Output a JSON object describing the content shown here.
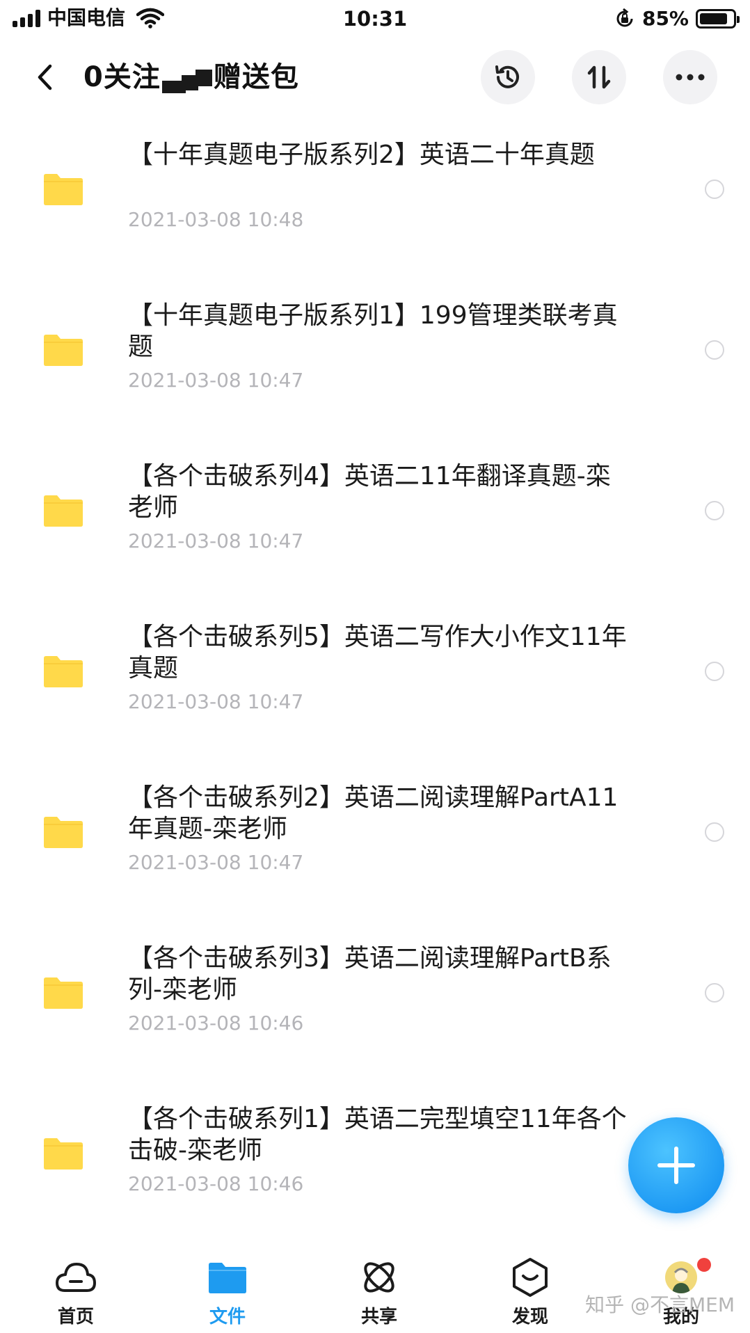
{
  "status_bar": {
    "carrier": "中国电信",
    "time": "10:31",
    "battery_percent": "85%",
    "battery_level": 0.85
  },
  "header": {
    "title_prefix": "0关注",
    "title_suffix": "赠送包",
    "buttons": {
      "back": "chevron-left-icon",
      "history": "history-icon",
      "sort": "sort-icon",
      "more": "more-horizontal-icon"
    }
  },
  "files": [
    {
      "name": "【十年真题电子版系列2】英语二十年真题",
      "date": "2021-03-08 10:48"
    },
    {
      "name": "【十年真题电子版系列1】199管理类联考真题",
      "date": "2021-03-08 10:47"
    },
    {
      "name": "【各个击破系列4】英语二11年翻译真题-栾老师",
      "date": "2021-03-08 10:47"
    },
    {
      "name": "【各个击破系列5】英语二写作大小作文11年真题",
      "date": "2021-03-08 10:47"
    },
    {
      "name": "【各个击破系列2】英语二阅读理解PartA11年真题-栾老师",
      "date": "2021-03-08 10:47"
    },
    {
      "name": "【各个击破系列3】英语二阅读理解PartB系列-栾老师",
      "date": "2021-03-08 10:46"
    },
    {
      "name": "【各个击破系列1】英语二完型填空11年各个击破-栾老师",
      "date": "2021-03-08 10:46"
    }
  ],
  "fab": {
    "icon": "plus-icon"
  },
  "bottom_nav": [
    {
      "label": "首页",
      "icon": "cloud-icon",
      "active": false
    },
    {
      "label": "文件",
      "icon": "folder-icon",
      "active": true
    },
    {
      "label": "共享",
      "icon": "share-orbit-icon",
      "active": false
    },
    {
      "label": "发现",
      "icon": "discover-icon",
      "active": false
    },
    {
      "label": "我的",
      "icon": "avatar-icon",
      "active": false
    }
  ],
  "watermark": "知乎 @不言MEM",
  "colors": {
    "accent": "#1e9bf0",
    "folder": "#ffd94a",
    "date_gray": "#b4b4b8",
    "badge_red": "#f0413d"
  }
}
